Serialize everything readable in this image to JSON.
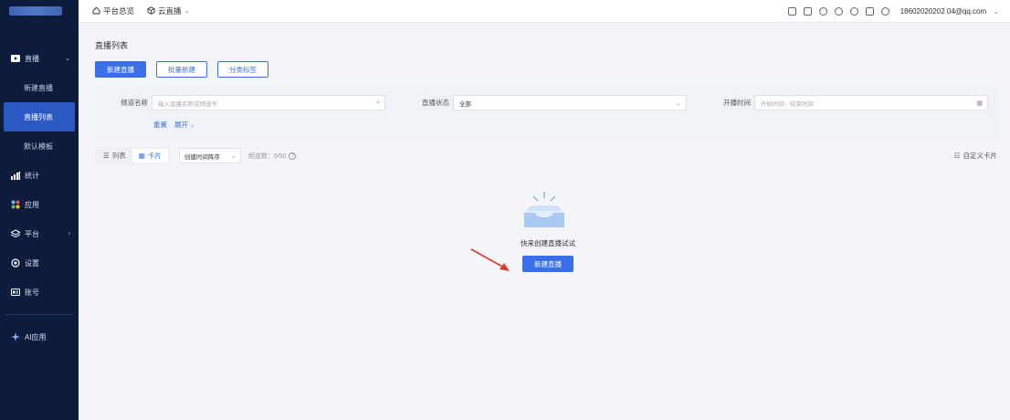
{
  "sidebar": {
    "items": [
      {
        "label": "直播",
        "icon": "video-icon"
      },
      {
        "label": "统计",
        "icon": "bar-chart-icon"
      },
      {
        "label": "应用",
        "icon": "grid-icon"
      },
      {
        "label": "平台",
        "icon": "layers-icon"
      },
      {
        "label": "设置",
        "icon": "settings-icon"
      },
      {
        "label": "账号",
        "icon": "id-card-icon"
      },
      {
        "label": "AI应用",
        "icon": "sparkle-icon"
      }
    ],
    "sub_items": [
      {
        "label": "新建直播"
      },
      {
        "label": "直播列表"
      },
      {
        "label": "默认模板"
      }
    ]
  },
  "topbar": {
    "nav": [
      {
        "label": "平台总览",
        "icon": "home-icon"
      },
      {
        "label": "云直播",
        "icon": "cube-icon"
      }
    ],
    "email": "18602020202 04@qq.com"
  },
  "main": {
    "page_title": "直播列表",
    "buttons": {
      "new_live": "新建直播",
      "batch_new": "批量新建",
      "category_tags": "分类标签"
    },
    "filters": {
      "channel_name_label": "频道名称",
      "channel_name_placeholder": "输入直播名称或频道号",
      "status_label": "直播状态",
      "status_value": "全部",
      "start_time_label": "开播时间",
      "start_time_placeholder": "开始时间 - 结束时间",
      "reset": "重置",
      "expand": "展开"
    },
    "view": {
      "list": "列表",
      "card": "卡片",
      "sort_value": "创建时间降序",
      "count": "频道数：0/50",
      "custom_card": "自定义卡片"
    },
    "empty": {
      "text": "快来创建直播试试",
      "button": "新建直播"
    }
  },
  "colors": {
    "sidebar_bg": "#0d1b3d",
    "accent": "#3a6fe8",
    "arrow": "#e03a2e"
  }
}
